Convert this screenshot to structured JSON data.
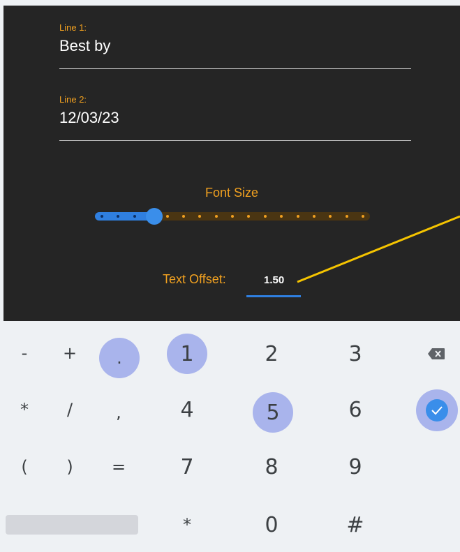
{
  "form": {
    "line1": {
      "label": "Line 1:",
      "value": "Best by"
    },
    "line2": {
      "label": "Line 2:",
      "value": "12/03/23"
    },
    "font_size": {
      "label": "Font Size",
      "level": 0.2,
      "steps": 17
    },
    "text_offset": {
      "label": "Text Offset:",
      "value": "1.50"
    }
  },
  "keyboard": {
    "row1": [
      "-",
      "+",
      ".",
      "1",
      "2",
      "3"
    ],
    "row2": [
      "*",
      "/",
      ",",
      "4",
      "5",
      "6"
    ],
    "row3": [
      "(",
      ")",
      "=",
      "7",
      "8",
      "9"
    ],
    "row4": [
      "*",
      "0",
      "#"
    ],
    "highlighted_keys": [
      ".",
      "1",
      "5"
    ],
    "backspace_icon": "backspace-icon",
    "enter_icon": "check-icon"
  },
  "colors": {
    "accent_orange": "#f0a020",
    "accent_blue": "#2f7fe0",
    "panel_bg": "#252525",
    "key_highlight": "#a9b4ec"
  }
}
